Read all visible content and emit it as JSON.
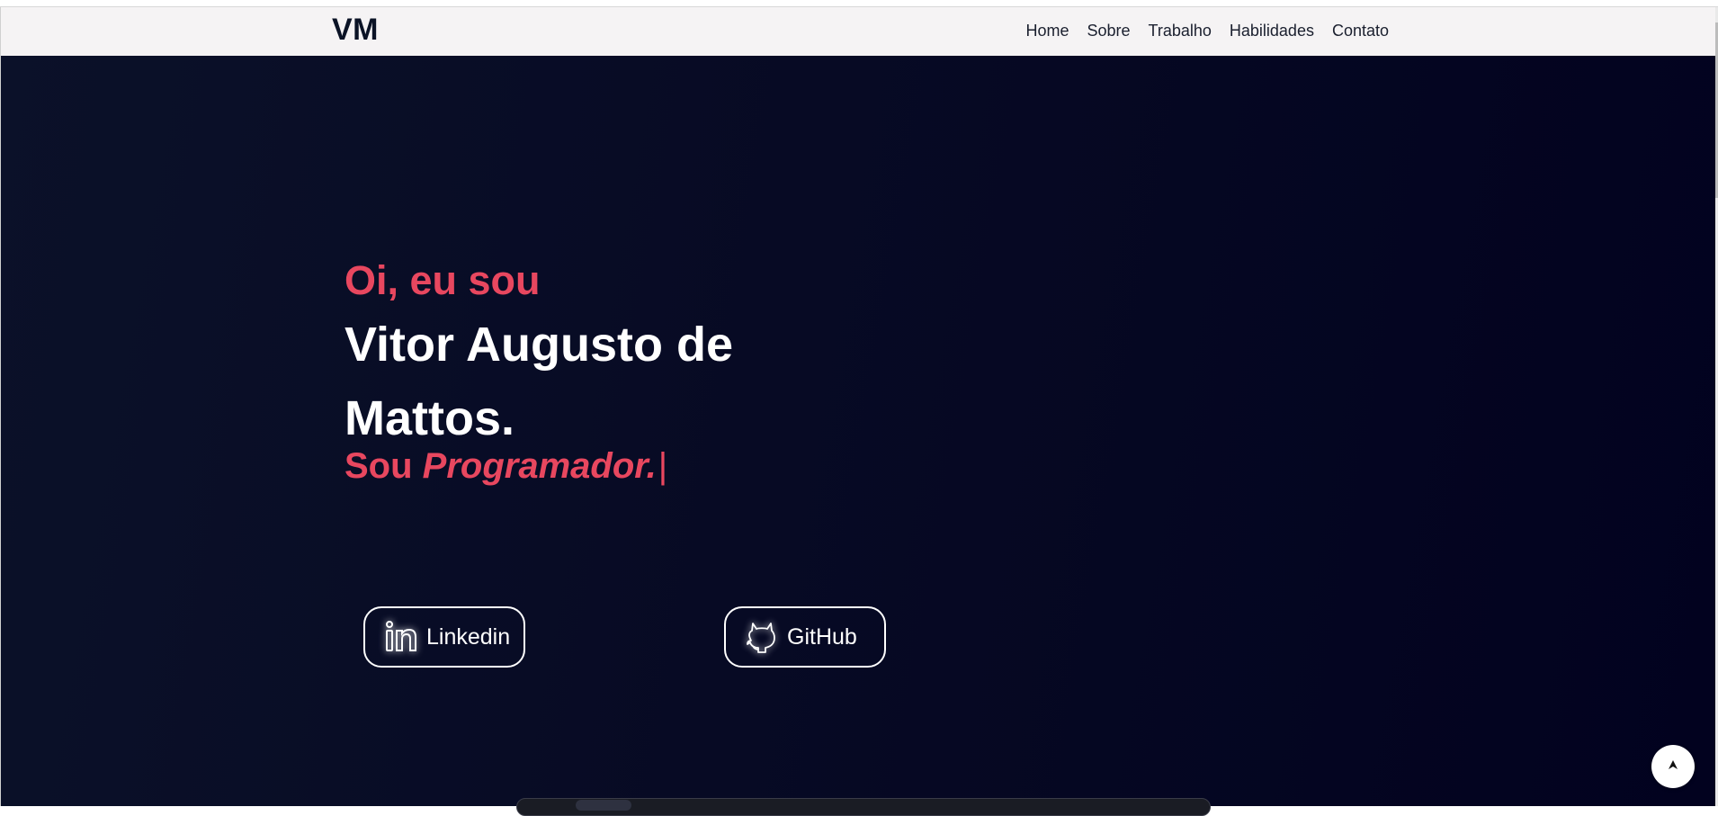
{
  "header": {
    "logo": "VM",
    "nav": [
      {
        "label": "Home"
      },
      {
        "label": "Sobre"
      },
      {
        "label": "Trabalho"
      },
      {
        "label": "Habilidades"
      },
      {
        "label": "Contato"
      }
    ]
  },
  "hero": {
    "greeting": "Oi, eu sou",
    "name": "Vitor Augusto de Mattos",
    "name_dot": ".",
    "role_prefix": "Sou ",
    "role_word": "Programador.",
    "cursor": "|",
    "buttons": [
      {
        "label": "Linkedin",
        "icon": "linkedin-icon"
      },
      {
        "label": "GitHub",
        "icon": "github-icon"
      }
    ]
  },
  "back_to_top": {
    "icon": "arrow-up-icon"
  },
  "colors": {
    "accent": "#e8475f",
    "hero_bg": "#070a24",
    "navbar_bg": "#f5f3f4",
    "text_dark": "#0b1326"
  }
}
